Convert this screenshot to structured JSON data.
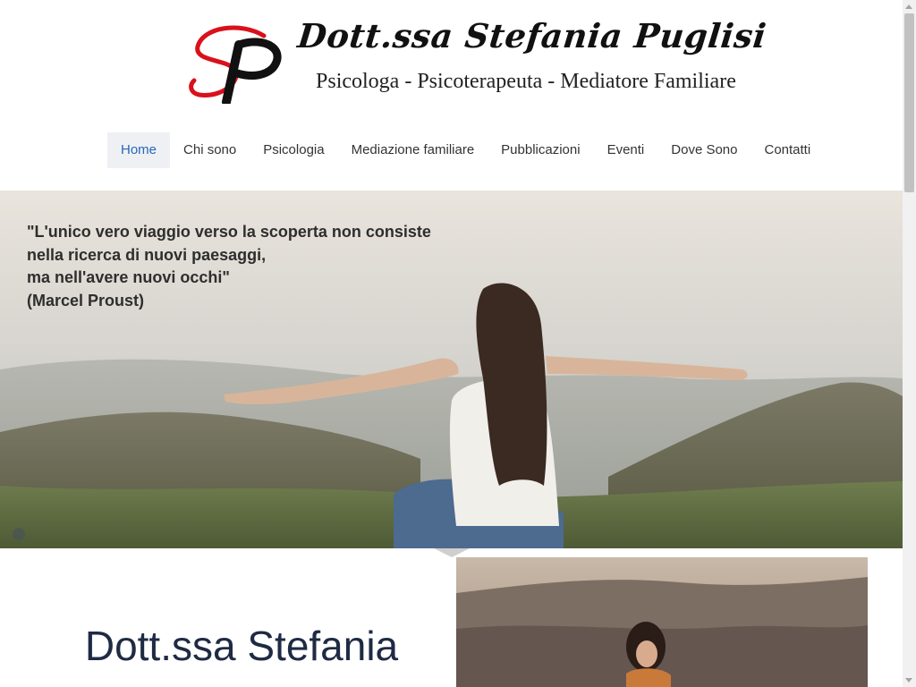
{
  "logo": {
    "initials": "SP",
    "name": "Dott.ssa Stefania Puglisi",
    "subtitle": "Psicologa - Psicoterapeuta - Mediatore Familiare",
    "colors": {
      "accent": "#d9111b",
      "text": "#111111"
    }
  },
  "nav": {
    "items": [
      {
        "label": "Home",
        "active": true
      },
      {
        "label": "Chi sono"
      },
      {
        "label": "Psicologia"
      },
      {
        "label": "Mediazione familiare"
      },
      {
        "label": "Pubblicazioni"
      },
      {
        "label": "Eventi"
      },
      {
        "label": "Dove Sono"
      },
      {
        "label": "Contatti"
      }
    ],
    "active_color": "#2a66b8"
  },
  "hero": {
    "quote_lines": [
      "\"L'unico vero viaggio verso la scoperta non consiste",
      "nella ricerca di nuovi paesaggi,",
      "ma nell'avere nuovi occhi\"",
      "(Marcel Proust)"
    ]
  },
  "intro": {
    "title": "Dott.ssa Stefania",
    "title_color": "#1f2a44"
  }
}
